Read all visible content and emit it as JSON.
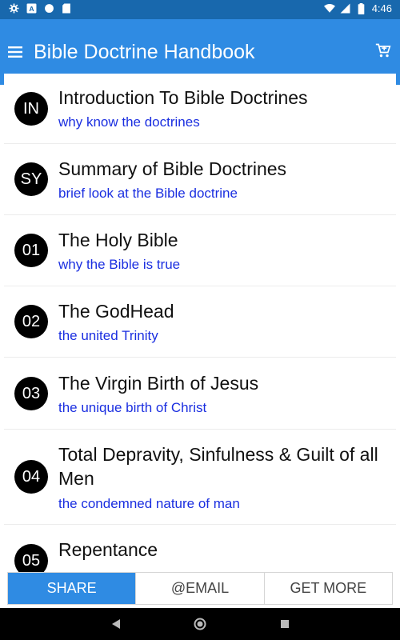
{
  "status_bar": {
    "time": "4:46",
    "left_icons": [
      "gear-icon",
      "a-icon",
      "circle-icon",
      "sd-card-icon"
    ],
    "right_icons": [
      "wifi-icon",
      "signal-icon",
      "battery-icon"
    ]
  },
  "app_bar": {
    "title": "Bible Doctrine Handbook",
    "menu_icon": "hamburger-icon",
    "cart_icon": "cart-icon",
    "color": "#2f8be3"
  },
  "items": [
    {
      "badge": "IN",
      "title": "Introduction To Bible Doctrines",
      "subtitle": "why know the doctrines"
    },
    {
      "badge": "SY",
      "title": "Summary of Bible Doctrines",
      "subtitle": "brief look at the Bible doctrine"
    },
    {
      "badge": "01",
      "title": "The Holy Bible",
      "subtitle": "why the Bible is true"
    },
    {
      "badge": "02",
      "title": "The GodHead",
      "subtitle": "the united Trinity"
    },
    {
      "badge": "03",
      "title": "The Virgin Birth of Jesus",
      "subtitle": "the unique birth of Christ"
    },
    {
      "badge": "04",
      "title": "Total Depravity, Sinfulness & Guilt of all Men",
      "subtitle": "the condemned nature of man"
    },
    {
      "badge": "05",
      "title": "Repentance",
      "subtitle": ""
    }
  ],
  "bottom_tabs": {
    "share": "SHARE",
    "email": "@EMAIL",
    "get_more": "GET MORE"
  },
  "nav_bar": {
    "back_icon": "back-triangle-icon",
    "home_icon": "home-circle-icon",
    "recents_icon": "recents-square-icon"
  }
}
